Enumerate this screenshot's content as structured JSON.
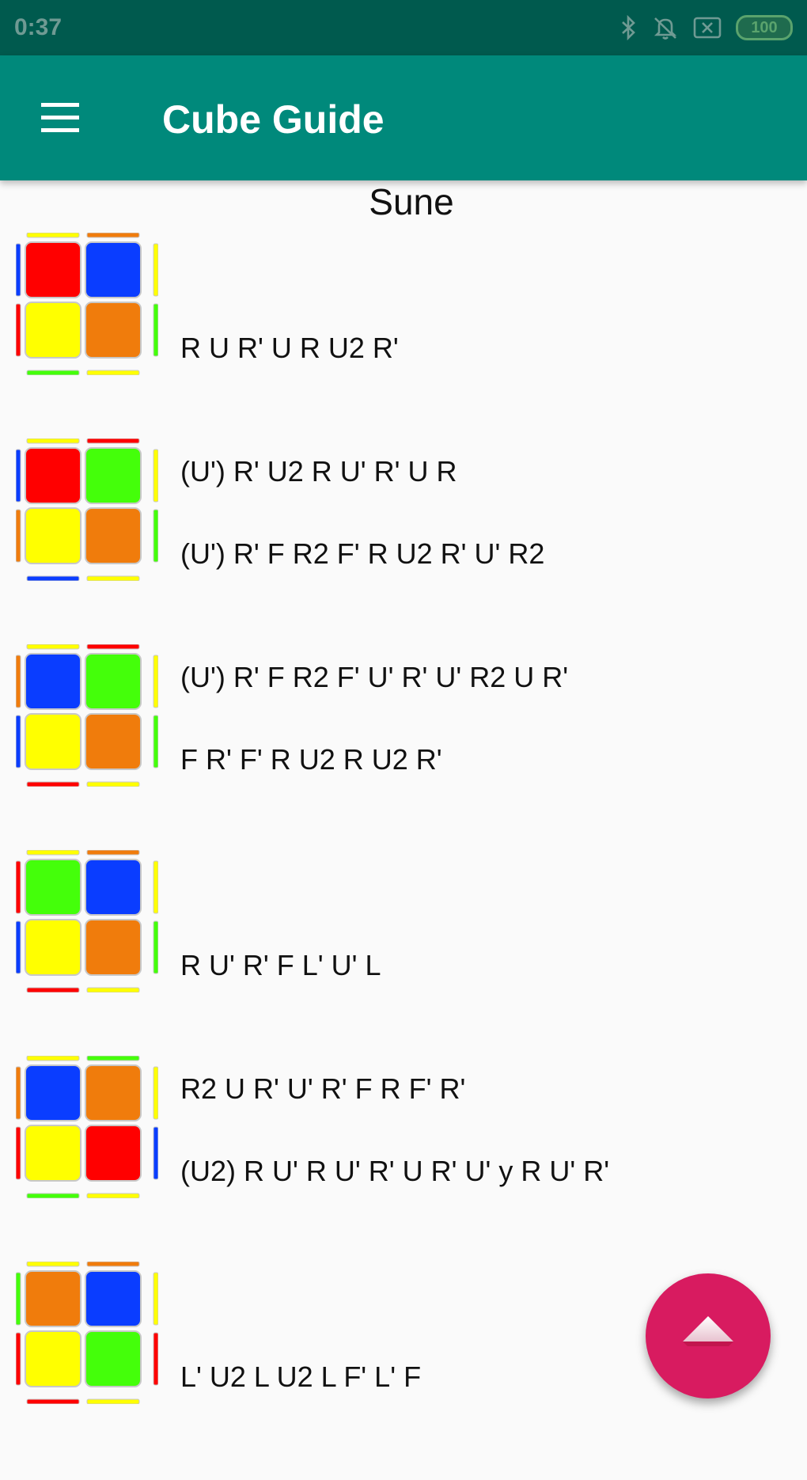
{
  "status_bar": {
    "time": "0:37",
    "battery": "100"
  },
  "app_bar": {
    "title": "Cube Guide"
  },
  "section": {
    "title": "Sune"
  },
  "cases": [
    {
      "algorithms": [
        "R U R' U R U2 R'",
        "(U') R' U2 R U' R' U R"
      ],
      "top": [
        "red",
        "blue",
        "yellow",
        "orange"
      ],
      "edges": {
        "top": [
          "yellow",
          "orange"
        ],
        "bottom": [
          "green",
          "yellow"
        ],
        "left": [
          "blue",
          "red"
        ],
        "right": [
          "yellow",
          "green"
        ]
      }
    },
    {
      "algorithms": [
        "(U') R' F R2 F' R U2 R' U' R2",
        "(U') R' F R2 F' U' R' U' R2 U R'"
      ],
      "top": [
        "red",
        "green",
        "yellow",
        "orange"
      ],
      "edges": {
        "top": [
          "yellow",
          "red"
        ],
        "bottom": [
          "blue",
          "yellow"
        ],
        "left": [
          "blue",
          "orange"
        ],
        "right": [
          "yellow",
          "green"
        ]
      }
    },
    {
      "algorithms": [
        "F R' F' R U2 R U2 R'"
      ],
      "top": [
        "blue",
        "green",
        "yellow",
        "orange"
      ],
      "edges": {
        "top": [
          "yellow",
          "red"
        ],
        "bottom": [
          "red",
          "yellow"
        ],
        "left": [
          "orange",
          "blue"
        ],
        "right": [
          "yellow",
          "green"
        ]
      }
    },
    {
      "algorithms": [
        "R U' R' F L' U' L",
        "R2 U R' U' R' F R F' R'"
      ],
      "top": [
        "green",
        "blue",
        "yellow",
        "orange"
      ],
      "edges": {
        "top": [
          "yellow",
          "orange"
        ],
        "bottom": [
          "red",
          "yellow"
        ],
        "left": [
          "red",
          "blue"
        ],
        "right": [
          "yellow",
          "green"
        ]
      }
    },
    {
      "algorithms": [
        "(U2) R U' R U' R' U R' U' y R U' R'"
      ],
      "top": [
        "blue",
        "orange",
        "yellow",
        "red"
      ],
      "edges": {
        "top": [
          "yellow",
          "green"
        ],
        "bottom": [
          "green",
          "yellow"
        ],
        "left": [
          "orange",
          "red"
        ],
        "right": [
          "yellow",
          "blue"
        ]
      }
    },
    {
      "algorithms": [
        "L' U2 L U2 L F' L' F"
      ],
      "top": [
        "orange",
        "blue",
        "yellow",
        "green"
      ],
      "edges": {
        "top": [
          "yellow",
          "orange"
        ],
        "bottom": [
          "red",
          "yellow"
        ],
        "left": [
          "green",
          "red"
        ],
        "right": [
          "yellow",
          "red"
        ]
      }
    }
  ],
  "colors": {
    "red": "#ff0000",
    "blue": "#0a3dff",
    "green": "#44ff0a",
    "yellow": "#ffff00",
    "orange": "#f07c0c",
    "app_bar": "#00897b",
    "status_bar": "#005a4e",
    "fab": "#d81b60"
  },
  "icons": {
    "menu": "menu-icon",
    "fab": "arrow-up-icon"
  }
}
